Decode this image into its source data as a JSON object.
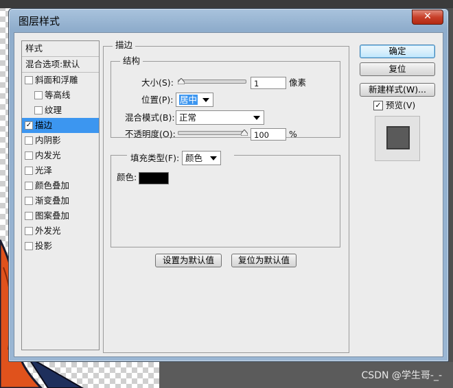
{
  "window": {
    "title": "图层样式",
    "close_glyph": "✕"
  },
  "left_panel": {
    "header_styles": "样式",
    "header_blending": "混合选项:默认",
    "items": [
      {
        "label": "斜面和浮雕",
        "checked": false,
        "indent": 0,
        "selected": false
      },
      {
        "label": "等高线",
        "checked": false,
        "indent": 1,
        "selected": false
      },
      {
        "label": "纹理",
        "checked": false,
        "indent": 1,
        "selected": false
      },
      {
        "label": "描边",
        "checked": true,
        "indent": 0,
        "selected": true
      },
      {
        "label": "内阴影",
        "checked": false,
        "indent": 0,
        "selected": false
      },
      {
        "label": "内发光",
        "checked": false,
        "indent": 0,
        "selected": false
      },
      {
        "label": "光泽",
        "checked": false,
        "indent": 0,
        "selected": false
      },
      {
        "label": "颜色叠加",
        "checked": false,
        "indent": 0,
        "selected": false
      },
      {
        "label": "渐变叠加",
        "checked": false,
        "indent": 0,
        "selected": false
      },
      {
        "label": "图案叠加",
        "checked": false,
        "indent": 0,
        "selected": false
      },
      {
        "label": "外发光",
        "checked": false,
        "indent": 0,
        "selected": false
      },
      {
        "label": "投影",
        "checked": false,
        "indent": 0,
        "selected": false
      }
    ]
  },
  "stroke": {
    "section_title": "描边",
    "structure": {
      "title": "结构",
      "size_label": "大小(S):",
      "size_value": "1",
      "size_unit": "像素",
      "size_slider_level": 0.01,
      "position_label": "位置(P):",
      "position_value": "居中",
      "blend_mode_label": "混合模式(B):",
      "blend_mode_value": "正常",
      "opacity_label": "不透明度(O):",
      "opacity_value": "100",
      "opacity_unit": "%",
      "opacity_slider_level": 1.0
    },
    "fill": {
      "fill_type_label": "填充类型(F):",
      "fill_type_value": "颜色",
      "color_label": "颜色:",
      "color_value": "#000000"
    },
    "make_default_label": "设置为默认值",
    "reset_default_label": "复位为默认值"
  },
  "right_buttons": {
    "ok": "确定",
    "reset": "复位",
    "new_style": "新建样式(W)...",
    "preview_label": "预览(V)",
    "preview_checked": true
  },
  "watermark": "CSDN @学生哥-_-",
  "colors": {
    "selection": "#3c96f0",
    "dialog_bg": "#ececec",
    "stroke_color": "#000000"
  }
}
